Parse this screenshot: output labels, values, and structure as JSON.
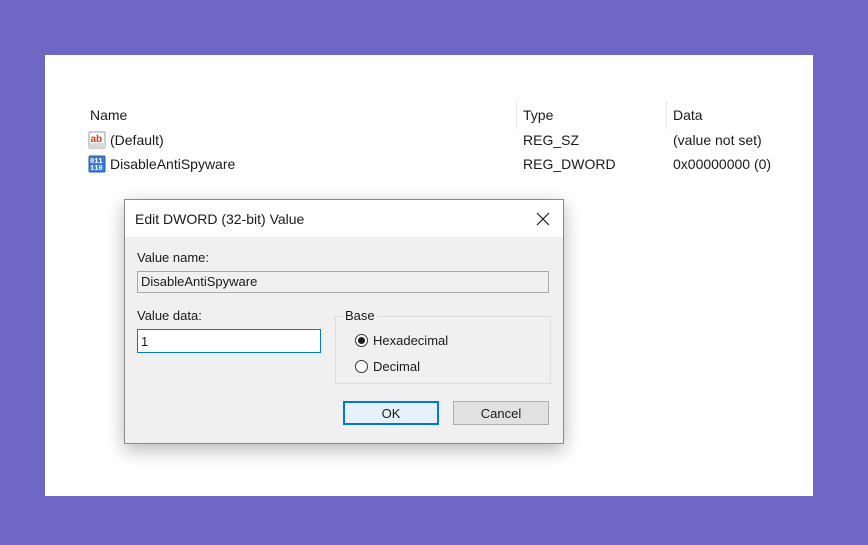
{
  "registry": {
    "columns": {
      "name": "Name",
      "type": "Type",
      "data": "Data"
    },
    "rows": [
      {
        "icon": "string-value-icon",
        "name": "(Default)",
        "type": "REG_SZ",
        "data": "(value not set)"
      },
      {
        "icon": "binary-value-icon",
        "name": "DisableAntiSpyware",
        "type": "REG_DWORD",
        "data": "0x00000000 (0)"
      }
    ]
  },
  "dialog": {
    "title": "Edit DWORD (32-bit) Value",
    "value_name_label": "Value name:",
    "value_name": "DisableAntiSpyware",
    "value_data_label": "Value data:",
    "value_data": "1",
    "base_label": "Base",
    "base_options": [
      {
        "label": "Hexadecimal",
        "checked": true
      },
      {
        "label": "Decimal",
        "checked": false
      }
    ],
    "ok_label": "OK",
    "cancel_label": "Cancel"
  },
  "colors": {
    "background": "#6e67c4",
    "accent": "#0078d7"
  }
}
